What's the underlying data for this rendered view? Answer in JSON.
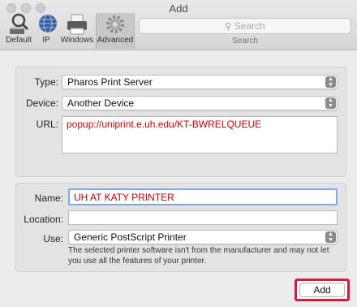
{
  "window": {
    "title": "Add"
  },
  "toolbar": {
    "items": [
      {
        "label": "Default",
        "icon": "default-printer-icon"
      },
      {
        "label": "IP",
        "icon": "globe-icon"
      },
      {
        "label": "Windows",
        "icon": "windows-printer-icon"
      },
      {
        "label": "Advanced",
        "icon": "gear-icon",
        "selected": true
      }
    ],
    "search": {
      "placeholder": "Search",
      "caption": "Search"
    }
  },
  "advanced": {
    "type": {
      "label": "Type:",
      "value": "Pharos Print Server"
    },
    "device": {
      "label": "Device:",
      "value": "Another Device"
    },
    "url": {
      "label": "URL:",
      "value": "popup://uniprint.e.uh.edu/KT-BWRELQUEUE"
    }
  },
  "details": {
    "name": {
      "label": "Name:",
      "value": "UH AT KATY PRINTER"
    },
    "location": {
      "label": "Location:",
      "value": ""
    },
    "use": {
      "label": "Use:",
      "value": "Generic PostScript Printer"
    },
    "note": "The selected printer software isn't from the manufacturer and may not let you use all the features of your printer."
  },
  "actions": {
    "add_label": "Add"
  },
  "colors": {
    "highlight": "#d61a3c",
    "url_text": "#cc0000"
  }
}
